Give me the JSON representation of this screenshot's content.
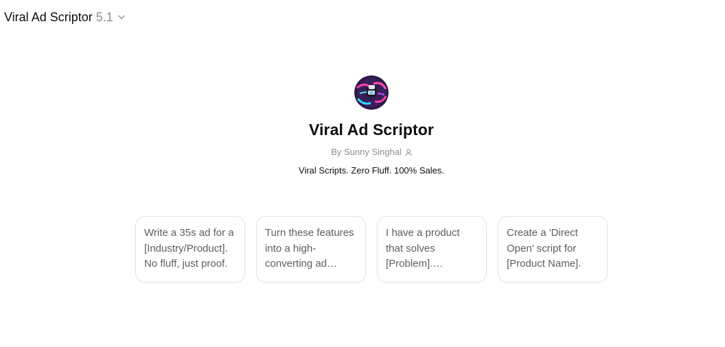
{
  "header": {
    "model_name": "Viral Ad Scriptor",
    "model_version": "5.1"
  },
  "profile": {
    "title": "Viral Ad Scriptor",
    "byline": "By Sunny Singhal",
    "tagline": "Viral Scripts. Zero Fluff. 100% Sales."
  },
  "starters": [
    {
      "text": "Write a 35s ad for a [Industry/Product]. No fluff, just proof."
    },
    {
      "text": "Turn these features into a high-converting ad focused on the benefits."
    },
    {
      "text": "I have a product that solves [Problem]. Generate a viral ad script."
    },
    {
      "text": "Create a 'Direct Open' script for [Product Name]."
    }
  ],
  "icons": {
    "chevron": "chevron-down-icon",
    "person": "person-icon"
  },
  "colors": {
    "text": "#0d0d0d",
    "muted": "#8e8e8e",
    "card_border": "#e3e3e3",
    "card_text": "#5d5d5d"
  }
}
